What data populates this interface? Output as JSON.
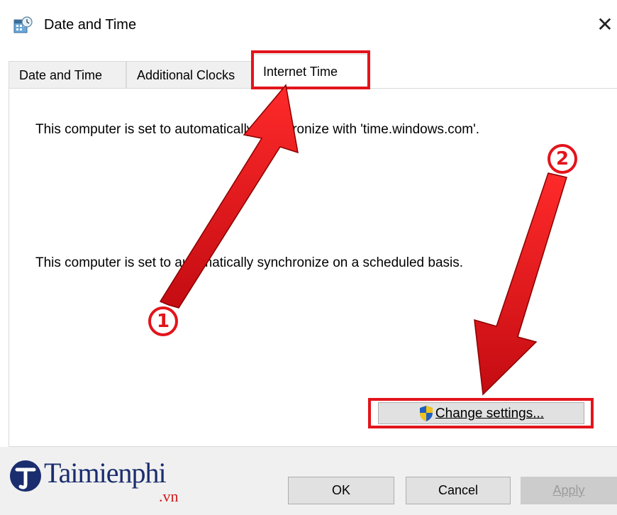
{
  "window": {
    "title": "Date and Time",
    "close_glyph": "✕",
    "icon": "calendar-clock-icon"
  },
  "tabs": [
    {
      "label": "Date and Time",
      "active": false
    },
    {
      "label": "Additional Clocks",
      "active": false
    },
    {
      "label": "Internet Time",
      "active": true
    }
  ],
  "content": {
    "sync_server_text": "This computer is set to automatically synchronize with 'time.windows.com'.",
    "schedule_text": "This computer is set to automatically synchronize on a scheduled basis.",
    "change_settings_label": "Change settings...",
    "change_settings_icon": "uac-shield-icon"
  },
  "footer": {
    "ok_label": "OK",
    "cancel_label": "Cancel",
    "apply_label": "Apply",
    "apply_enabled": false
  },
  "watermark": {
    "brand": "Taimienphi",
    "suffix": ".vn"
  },
  "annotations": {
    "step1": "1",
    "step2": "2",
    "color": "#e3141b"
  }
}
